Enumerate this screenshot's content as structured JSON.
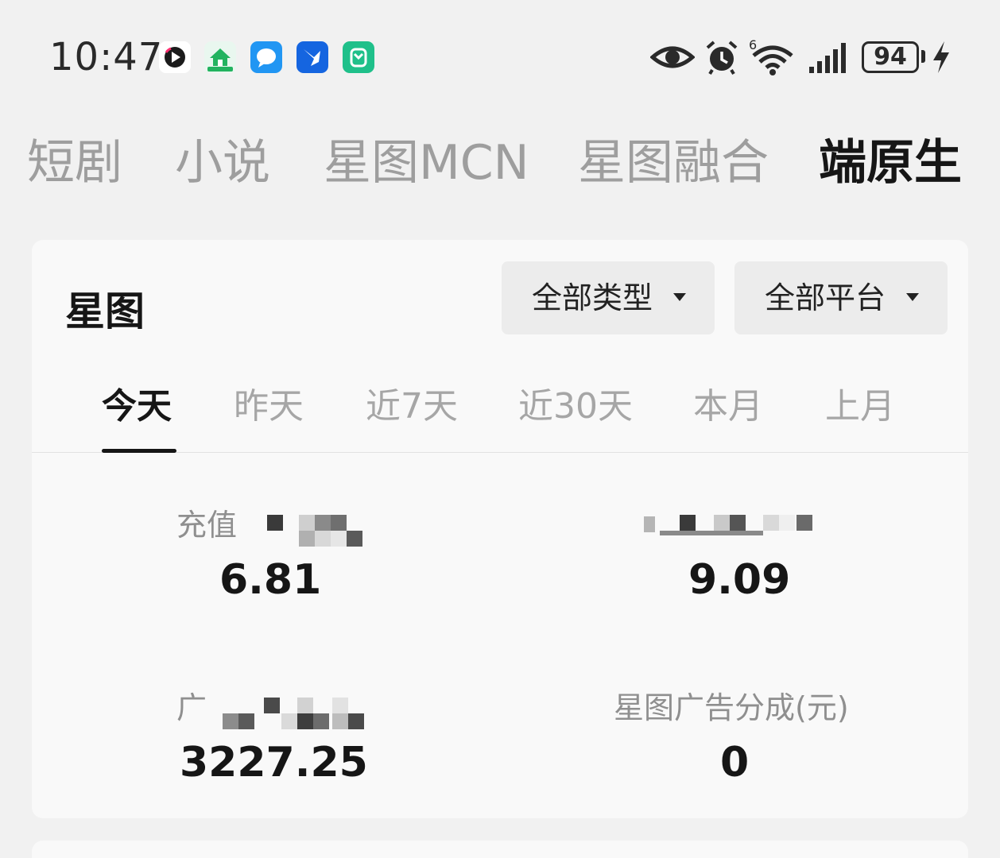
{
  "status_bar": {
    "time": "10:47",
    "battery": "94",
    "wifi_badge": "6",
    "app_icons": [
      "video-app-icon",
      "vr-house-app-icon",
      "message-app-icon",
      "bird-app-icon",
      "mi-home-app-icon"
    ],
    "system_icons": [
      "eye-icon",
      "alarm-icon",
      "wifi-icon",
      "signal-icon",
      "battery-icon",
      "charging-icon"
    ]
  },
  "top_tabs": [
    {
      "label": "短剧",
      "active": false
    },
    {
      "label": "小说",
      "active": false
    },
    {
      "label": "星图MCN",
      "active": false
    },
    {
      "label": "星图融合",
      "active": false
    },
    {
      "label": "端原生",
      "active": true
    }
  ],
  "card": {
    "title": "星图",
    "filters": [
      {
        "label": "全部类型"
      },
      {
        "label": "全部平台"
      }
    ],
    "date_tabs": [
      {
        "label": "今天",
        "active": true
      },
      {
        "label": "昨天",
        "active": false
      },
      {
        "label": "近7天",
        "active": false
      },
      {
        "label": "近30天",
        "active": false
      },
      {
        "label": "本月",
        "active": false
      },
      {
        "label": "上月",
        "active": false
      }
    ],
    "metrics": [
      {
        "label": "充值",
        "value": "6.81"
      },
      {
        "label": "",
        "value": "9.09"
      },
      {
        "label": "广",
        "value": "3227.25"
      },
      {
        "label": "星图广告分成(元)",
        "value": "0"
      }
    ]
  },
  "colors": {
    "background": "#f1f1f1",
    "card": "#f9f9f9",
    "text_primary": "#161616",
    "text_secondary": "#9e9e9e",
    "filter_bg": "#ececec"
  }
}
